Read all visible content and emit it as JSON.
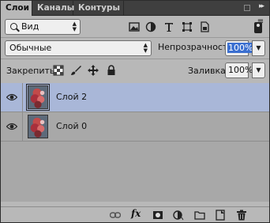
{
  "tabs": [
    {
      "label": "Слои",
      "active": true
    },
    {
      "label": "Каналы",
      "active": false
    },
    {
      "label": "Контуры",
      "active": false
    }
  ],
  "filter": {
    "kind_label": "Вид",
    "icons": [
      "image-filter-icon",
      "adjustment-filter-icon",
      "type-filter-icon",
      "shape-filter-icon",
      "smart-object-filter-icon"
    ]
  },
  "blend": {
    "mode": "Обычные",
    "opacity_label": "Непрозрачность:",
    "opacity_value": "100%"
  },
  "lock": {
    "label": "Закрепить:",
    "icons": [
      "lock-transparent-icon",
      "lock-pixels-icon",
      "lock-position-icon",
      "lock-all-icon"
    ],
    "fill_label": "Заливка:",
    "fill_value": "100%"
  },
  "layers": [
    {
      "name": "Слой 2",
      "selected": true,
      "visible": true
    },
    {
      "name": "Слой 0",
      "selected": false,
      "visible": true
    }
  ],
  "footer": {
    "icons": [
      "link-layers-icon",
      "fx-icon",
      "add-mask-icon",
      "adjustment-layer-icon",
      "new-group-icon",
      "new-layer-icon",
      "delete-layer-icon"
    ],
    "fx_label": "fx"
  },
  "colors": {
    "selected_row": "#a9b7d8",
    "panel_bg": "#b8b8b8",
    "selection_highlight": "#3b6fd0"
  }
}
